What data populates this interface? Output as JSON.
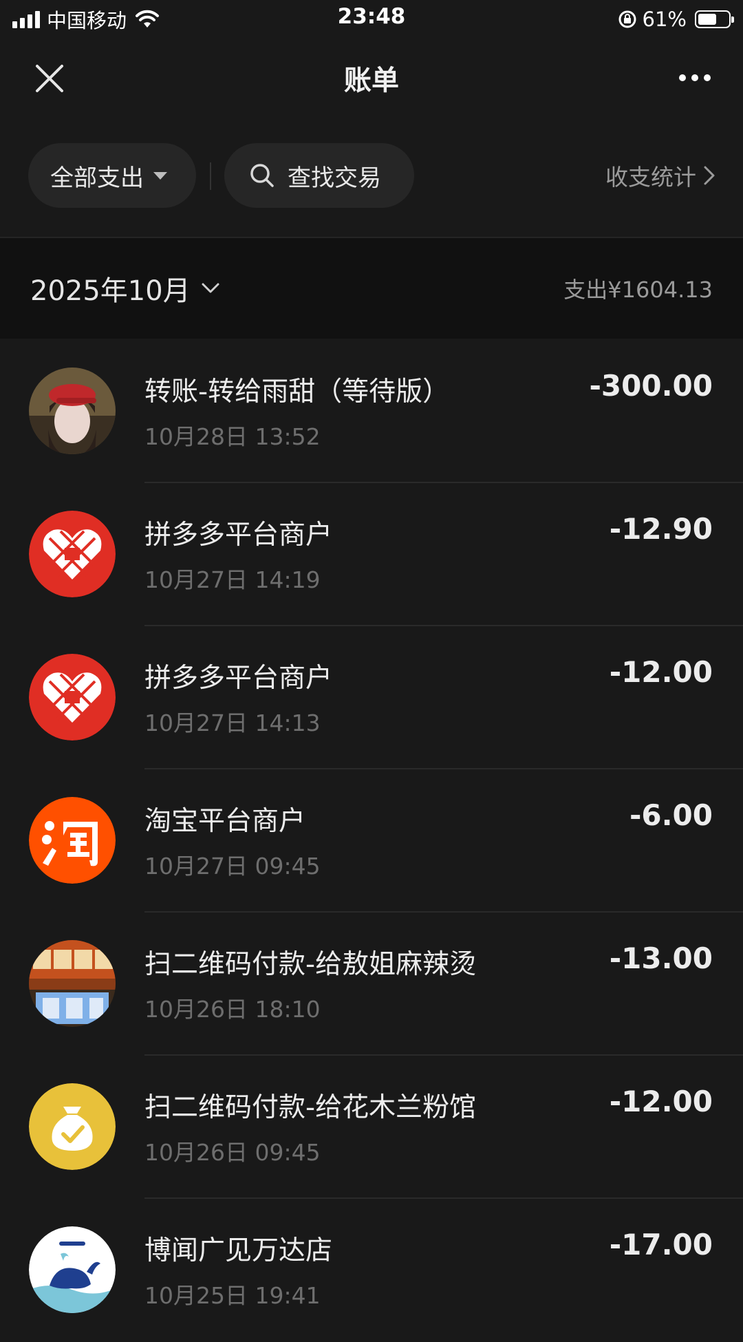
{
  "status_bar": {
    "carrier": "中国移动",
    "time": "23:48",
    "battery_percent": "61%",
    "battery_level": 0.61
  },
  "nav": {
    "title": "账单",
    "close_icon": "close-icon",
    "more_icon": "more-icon"
  },
  "filters": {
    "type_label": "全部支出",
    "search_label": "查找交易",
    "stats_label": "收支统计"
  },
  "month": {
    "label": "2025年10月",
    "summary": "支出¥1604.13"
  },
  "transactions": [
    {
      "name": "转账-转给雨甜（等待版）",
      "time": "10月28日 13:52",
      "amount": "-300.00",
      "avatar": "person-photo"
    },
    {
      "name": "拼多多平台商户",
      "time": "10月27日 14:19",
      "amount": "-12.90",
      "avatar": "pinduoduo-logo"
    },
    {
      "name": "拼多多平台商户",
      "time": "10月27日 14:13",
      "amount": "-12.00",
      "avatar": "pinduoduo-logo"
    },
    {
      "name": "淘宝平台商户",
      "time": "10月27日 09:45",
      "amount": "-6.00",
      "avatar": "taobao-logo"
    },
    {
      "name": "扫二维码付款-给敖姐麻辣烫",
      "time": "10月26日 18:10",
      "amount": "-13.00",
      "avatar": "shop-photo"
    },
    {
      "name": "扫二维码付款-给花木兰粉馆",
      "time": "10月26日 09:45",
      "amount": "-12.00",
      "avatar": "money-bag-icon"
    },
    {
      "name": "博闻广见万达店",
      "time": "10月25日 19:41",
      "amount": "-17.00",
      "avatar": "whale-logo"
    }
  ],
  "colors": {
    "background": "#191919",
    "month_header": "#111111",
    "pinduoduo_red": "#e02e24",
    "taobao_orange": "#ff5000",
    "bag_yellow": "#e8c13a"
  }
}
